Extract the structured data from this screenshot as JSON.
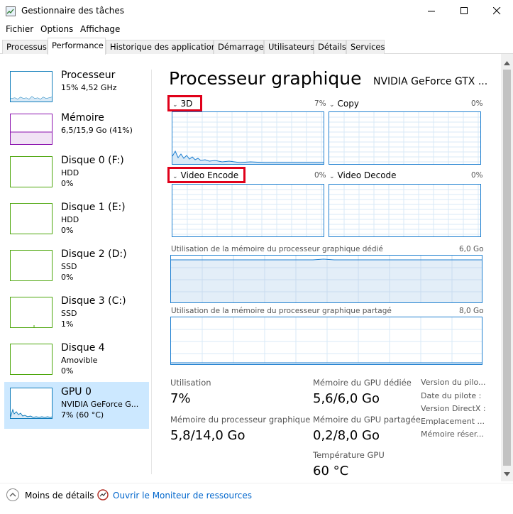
{
  "window": {
    "title": "Gestionnaire des tâches",
    "controls": [
      "minimize-icon",
      "maximize-icon",
      "close-icon"
    ]
  },
  "menu": [
    "Fichier",
    "Options",
    "Affichage"
  ],
  "tabs": [
    {
      "label": "Processus",
      "active": false
    },
    {
      "label": "Performance",
      "active": true
    },
    {
      "label": "Historique des applications",
      "active": false
    },
    {
      "label": "Démarrage",
      "active": false
    },
    {
      "label": "Utilisateurs",
      "active": false
    },
    {
      "label": "Détails",
      "active": false
    },
    {
      "label": "Services",
      "active": false
    }
  ],
  "sidebar": {
    "items": [
      {
        "name": "Processeur",
        "line1": "15% 4,52 GHz",
        "line2": "",
        "color": "#117dbb"
      },
      {
        "name": "Mémoire",
        "line1": "6,5/15,9 Go (41%)",
        "line2": "",
        "color": "#8b12ae"
      },
      {
        "name": "Disque 0 (F:)",
        "line1": "HDD",
        "line2": "0%",
        "color": "#4da60c"
      },
      {
        "name": "Disque 1 (E:)",
        "line1": "HDD",
        "line2": "0%",
        "color": "#4da60c"
      },
      {
        "name": "Disque 2 (D:)",
        "line1": "SSD",
        "line2": "0%",
        "color": "#4da60c"
      },
      {
        "name": "Disque 3 (C:)",
        "line1": "SSD",
        "line2": "1%",
        "color": "#4da60c"
      },
      {
        "name": "Disque 4",
        "line1": "Amovible",
        "line2": "0%",
        "color": "#4da60c"
      },
      {
        "name": "GPU 0",
        "line1": "NVIDIA GeForce G...",
        "line2": "7% (60 °C)",
        "color": "#117dbb",
        "selected": true
      }
    ]
  },
  "main": {
    "title": "Processeur graphique",
    "gpu_name": "NVIDIA GeForce GTX ...",
    "engines": [
      {
        "label": "3D",
        "pct": "7%"
      },
      {
        "label": "Copy",
        "pct": "0%"
      },
      {
        "label": "Video Encode",
        "pct": "0%"
      },
      {
        "label": "Video Decode",
        "pct": "0%"
      }
    ],
    "dedicated_mem_label": "Utilisation de la mémoire du processeur graphique dédié",
    "dedicated_mem_max": "6,0 Go",
    "shared_mem_label": "Utilisation de la mémoire du processeur graphique partagé",
    "shared_mem_max": "8,0 Go",
    "stats": {
      "utilisation_label": "Utilisation",
      "utilisation_value": "7%",
      "gpu_mem_label": "Mémoire du processeur graphique",
      "gpu_mem_value": "5,8/14,0 Go",
      "dedicated_label": "Mémoire du GPU dédiée",
      "dedicated_value": "5,6/6,0 Go",
      "shared_label": "Mémoire du GPU partagée",
      "shared_value": "0,2/8,0 Go",
      "temp_label": "Température GPU",
      "temp_value": "60 °C"
    },
    "info_labels": [
      "Version du pilo...",
      "Date du pilote :",
      "Version DirectX :",
      "Emplacement ...",
      "Mémoire réser..."
    ]
  },
  "footer": {
    "less_details": "Moins de détails",
    "resource_monitor": "Ouvrir le Moniteur de ressources"
  },
  "colors": {
    "accent": "#1e7fd0",
    "highlight": "#e0001a",
    "selection": "#cce8ff"
  }
}
